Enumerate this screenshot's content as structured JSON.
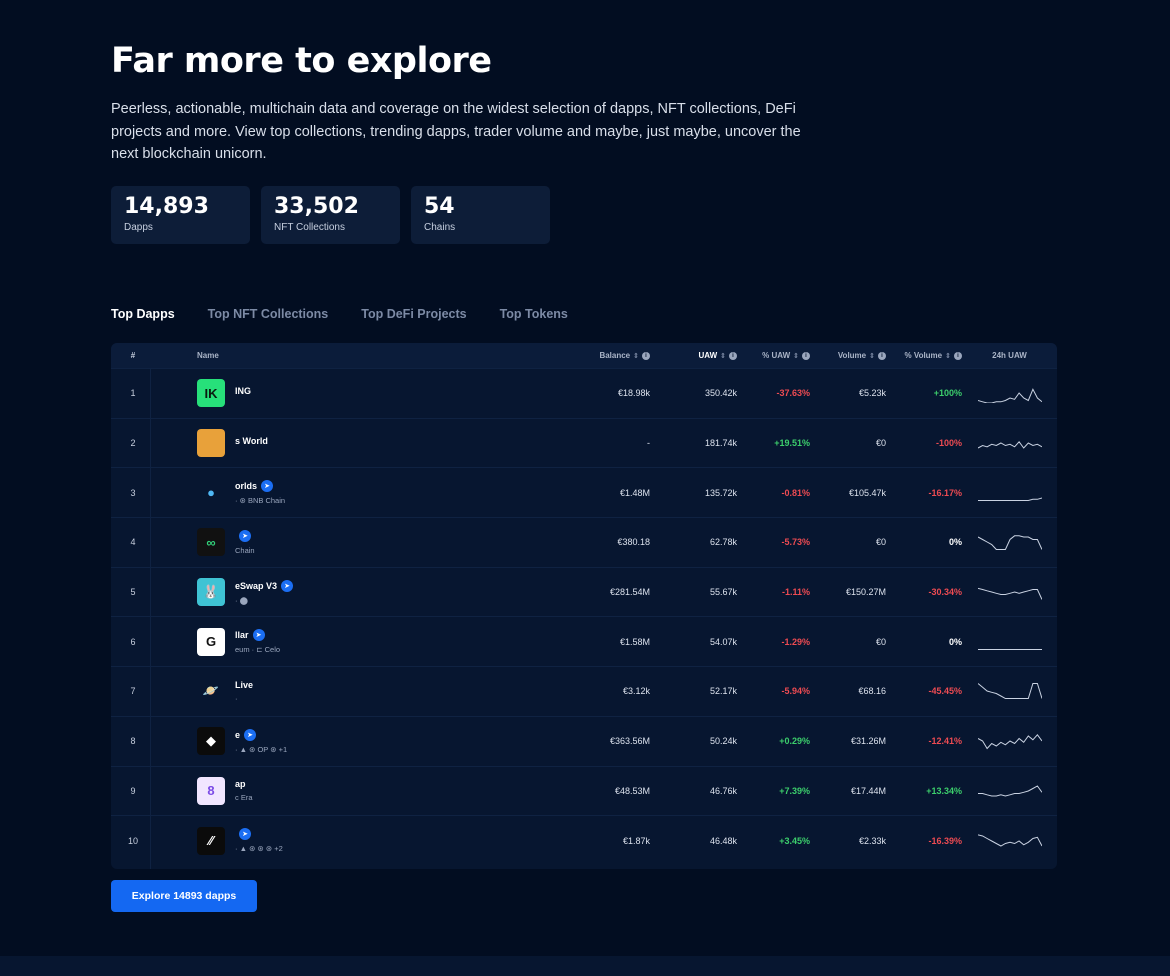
{
  "hero": {
    "title": "Far more to explore",
    "description": "Peerless, actionable, multichain data and coverage on the widest selection of dapps, NFT collections, DeFi projects and more. View top collections, trending dapps, trader volume and maybe, just maybe, uncover the next blockchain unicorn."
  },
  "stats": [
    {
      "value": "14,893",
      "label": "Dapps"
    },
    {
      "value": "33,502",
      "label": "NFT Collections"
    },
    {
      "value": "54",
      "label": "Chains"
    }
  ],
  "tabs": [
    "Top Dapps",
    "Top NFT Collections",
    "Top DeFi Projects",
    "Top Tokens"
  ],
  "table": {
    "headers": {
      "rank": "#",
      "name": "Name",
      "balance": "Balance",
      "uaw": "UAW",
      "pct_uaw": "% UAW",
      "volume": "Volume",
      "pct_volume": "% Volume",
      "spark": "24h UAW"
    },
    "rows": [
      {
        "rank": "1",
        "name": "ING",
        "sub": "",
        "balance": "€18.98k",
        "uaw": "350.42k",
        "pct_uaw": "-37.63%",
        "volume": "€5.23k",
        "pct_volume": "+100%",
        "logo_bg": "#27e07a",
        "logo_fg": "#0a1a10",
        "logo_text": "IK",
        "spark": [
          14,
          15,
          16,
          16,
          15,
          15,
          14,
          12,
          13,
          8,
          12,
          14,
          5,
          12,
          15
        ]
      },
      {
        "rank": "2",
        "name": "s World",
        "sub": "",
        "balance": "-",
        "uaw": "181.74k",
        "pct_uaw": "+19.51%",
        "volume": "€0",
        "pct_volume": "-100%",
        "logo_bg": "#e8a13a",
        "logo_fg": "#2a1a00",
        "logo_text": "",
        "spark": [
          12,
          10,
          11,
          9,
          10,
          8,
          10,
          9,
          11,
          7,
          12,
          8,
          10,
          9,
          11
        ]
      },
      {
        "rank": "3",
        "name": "orlds",
        "sub": "· ⊛ BNB Chain",
        "balance": "€1.48M",
        "uaw": "135.72k",
        "pct_uaw": "-0.81%",
        "volume": "€105.47k",
        "pct_volume": "-16.17%",
        "logo_bg": "transparent",
        "logo_fg": "#4fb8f5",
        "logo_text": "●",
        "spark": [
          14,
          14,
          14,
          14,
          14,
          14,
          14,
          14,
          14,
          14,
          14,
          14,
          13,
          13,
          12
        ]
      },
      {
        "rank": "4",
        "name": "",
        "sub": "Chain",
        "balance": "€380.18",
        "uaw": "62.78k",
        "pct_uaw": "-5.73%",
        "volume": "€0",
        "pct_volume": "0%",
        "logo_bg": "#111111",
        "logo_fg": "#32d17a",
        "logo_text": "∞",
        "spark": [
          4,
          6,
          8,
          10,
          14,
          14,
          14,
          6,
          3,
          3,
          4,
          4,
          6,
          6,
          14
        ]
      },
      {
        "rank": "5",
        "name": "eSwap V3",
        "sub": "· ⬤",
        "balance": "€281.54M",
        "uaw": "55.67k",
        "pct_uaw": "-1.11%",
        "volume": "€150.27M",
        "pct_volume": "-30.34%",
        "logo_bg": "#3fc3d4",
        "logo_fg": "#6b3a12",
        "logo_text": "🐰",
        "spark": [
          5,
          6,
          7,
          8,
          9,
          10,
          10,
          9,
          8,
          9,
          8,
          7,
          6,
          6,
          14
        ]
      },
      {
        "rank": "6",
        "name": "llar",
        "sub": "eum · ⊏ Celo",
        "balance": "€1.58M",
        "uaw": "54.07k",
        "pct_uaw": "-1.29%",
        "volume": "€0",
        "pct_volume": "0%",
        "logo_bg": "#ffffff",
        "logo_fg": "#111111",
        "logo_text": "G",
        "spark": [
          14,
          14,
          14,
          14,
          14,
          14,
          14,
          14,
          14,
          14,
          14,
          14,
          14,
          14,
          14
        ]
      },
      {
        "rank": "7",
        "name": "Live",
        "sub": "·",
        "balance": "€3.12k",
        "uaw": "52.17k",
        "pct_uaw": "-5.94%",
        "volume": "€68.16",
        "pct_volume": "-45.45%",
        "logo_bg": "transparent",
        "logo_fg": "#c04ad8",
        "logo_text": "🪐",
        "spark": [
          2,
          5,
          8,
          9,
          10,
          12,
          14,
          14,
          14,
          14,
          14,
          14,
          2,
          2,
          14
        ]
      },
      {
        "rank": "8",
        "name": "e",
        "sub": "· ▲ ⊛ OP ⊛ +1",
        "balance": "€363.56M",
        "uaw": "50.24k",
        "pct_uaw": "+0.29%",
        "volume": "€31.26M",
        "pct_volume": "-12.41%",
        "logo_bg": "#0b0b0b",
        "logo_fg": "#ffffff",
        "logo_text": "◆",
        "spark": [
          6,
          8,
          14,
          10,
          12,
          9,
          11,
          8,
          10,
          6,
          9,
          4,
          7,
          3,
          8
        ]
      },
      {
        "rank": "9",
        "name": "ap",
        "sub": "c Era",
        "balance": "€48.53M",
        "uaw": "46.76k",
        "pct_uaw": "+7.39%",
        "volume": "€17.44M",
        "pct_volume": "+13.34%",
        "logo_bg": "#f1e6ff",
        "logo_fg": "#7b4be6",
        "logo_text": "8",
        "spark": [
          10,
          10,
          11,
          12,
          12,
          11,
          12,
          11,
          10,
          10,
          9,
          8,
          6,
          4,
          9
        ]
      },
      {
        "rank": "10",
        "name": "",
        "sub": "· ▲ ⊛ ⊛ ⊛ +2",
        "balance": "€1.87k",
        "uaw": "46.48k",
        "pct_uaw": "+3.45%",
        "volume": "€2.33k",
        "pct_volume": "-16.39%",
        "logo_bg": "#0b0b0b",
        "logo_fg": "#ffffff",
        "logo_text": "⁄⁄",
        "spark": [
          3,
          4,
          6,
          8,
          10,
          12,
          10,
          9,
          10,
          8,
          11,
          9,
          6,
          5,
          12
        ]
      }
    ]
  },
  "explore_button": "Explore 14893 dapps",
  "colors": {
    "background": "#020d21",
    "card": "#0d1d38",
    "accent": "#1468f2",
    "negative": "#ee4b52",
    "positive": "#3ccf6c"
  }
}
